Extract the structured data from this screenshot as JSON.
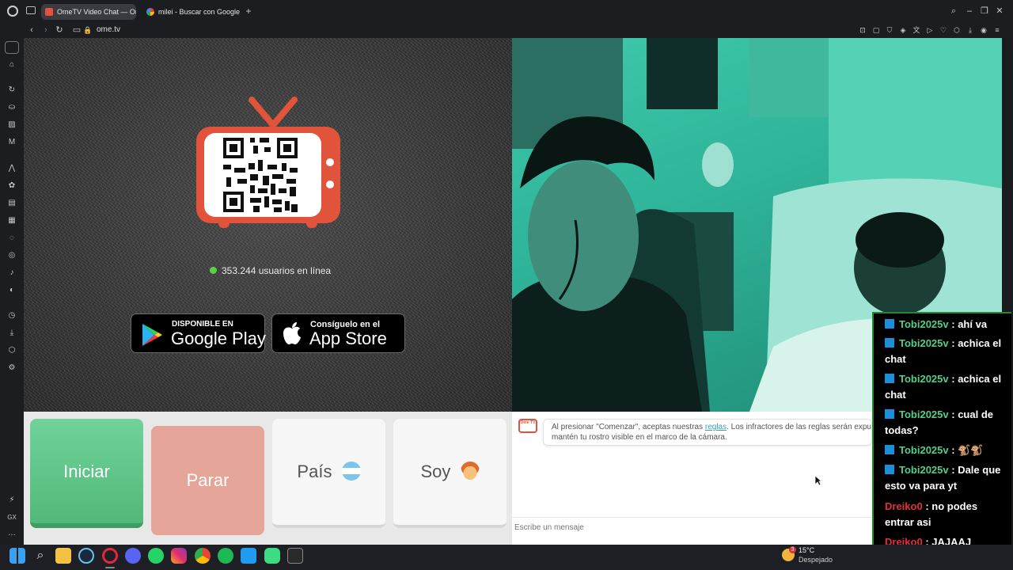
{
  "browser": {
    "tabs": [
      {
        "label": "OmeTV Video Chat — Om",
        "active": true
      },
      {
        "label": "milei - Buscar con Google",
        "active": false
      }
    ],
    "new_tab": "+",
    "url": "ome.tv"
  },
  "sidebar": {
    "icons": [
      "home-icon",
      "gamepad-icon",
      "refresh-icon",
      "bag-icon",
      "ai-icon",
      "messenger-icon",
      "chatgpt-icon",
      "vk-icon",
      "twitch-icon",
      "whatsapp-icon",
      "instagram-icon",
      "tiktok-icon",
      "discord-icon",
      "history-icon",
      "download-icon",
      "extensions-icon",
      "settings-icon"
    ],
    "bottom_label": "GX"
  },
  "ometv": {
    "online_count": "353.244 usuarios en línea",
    "google_play": {
      "small": "DISPONIBLE EN",
      "big": "Google Play"
    },
    "app_store": {
      "small": "Consíguelo en el",
      "big": "App Store"
    },
    "buttons": {
      "start": "Iniciar",
      "stop": "Parar",
      "country": "País",
      "gender": "Soy"
    },
    "chat": {
      "notice_pre": "Al presionar \"Comenzar\", aceptas nuestras ",
      "notice_link": "reglas",
      "notice_post": ". Los infractores de las reglas serán expuls",
      "notice_line2": "mantén tu rostro visible en el marco de la cámara.",
      "logo_text": "Ome TV",
      "placeholder": "Escribe un mensaje"
    }
  },
  "stream_chat": [
    {
      "user": "Tobi2025v",
      "text": ": ahí va",
      "color": "green"
    },
    {
      "user": "Tobi2025v",
      "text": ": achica el chat",
      "color": "green"
    },
    {
      "user": "Tobi2025v",
      "text": ": achica el chat",
      "color": "green"
    },
    {
      "user": "Tobi2025v",
      "text": ": cual de todas?",
      "color": "green"
    },
    {
      "user": "Tobi2025v",
      "text": ": 🐒🐒",
      "color": "green"
    },
    {
      "user": "Tobi2025v",
      "text": ": Dale que esto va para yt",
      "color": "green"
    },
    {
      "user": "Dreiko0",
      "text": ": no podes entrar asi",
      "color": "red"
    },
    {
      "user": "Dreiko0",
      "text": ": JAJAAJ",
      "color": "red"
    }
  ],
  "taskbar": {
    "weather_temp": "15°C",
    "weather_desc": "Despejado",
    "weather_badge": "3",
    "apps": [
      "windows-icon",
      "search-icon",
      "file-explorer-icon",
      "steam-icon",
      "opera-gx-icon",
      "discord-icon",
      "whatsapp-icon",
      "instagram-icon",
      "chrome-icon",
      "spotify-icon",
      "vscode-icon",
      "android-icon",
      "epic-games-icon"
    ]
  },
  "colors": {
    "start": "#5ec48a",
    "stop": "#e5a598",
    "accent_green": "#52d08a",
    "ometv_red": "#e2533b"
  }
}
